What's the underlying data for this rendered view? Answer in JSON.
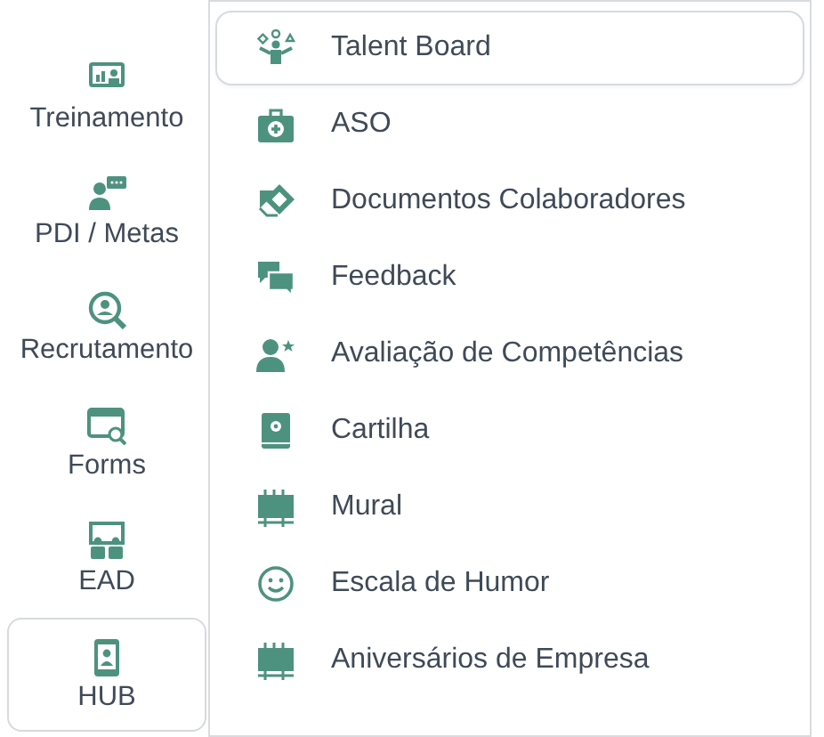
{
  "sidebar": {
    "items": [
      {
        "label": "Treinamento",
        "selected": false
      },
      {
        "label": "PDI / Metas",
        "selected": false
      },
      {
        "label": "Recrutamento",
        "selected": false
      },
      {
        "label": "Forms",
        "selected": false
      },
      {
        "label": "EAD",
        "selected": false
      },
      {
        "label": "HUB",
        "selected": true
      }
    ]
  },
  "menu": {
    "items": [
      {
        "label": "Talent Board",
        "selected": true
      },
      {
        "label": "ASO",
        "selected": false
      },
      {
        "label": "Documentos Colaboradores",
        "selected": false
      },
      {
        "label": "Feedback",
        "selected": false
      },
      {
        "label": "Avaliação de Competências",
        "selected": false
      },
      {
        "label": "Cartilha",
        "selected": false
      },
      {
        "label": "Mural",
        "selected": false
      },
      {
        "label": "Escala de Humor",
        "selected": false
      },
      {
        "label": "Aniversários de Empresa",
        "selected": false
      }
    ]
  }
}
